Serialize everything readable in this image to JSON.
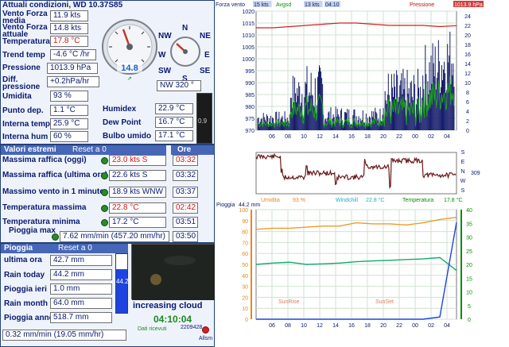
{
  "current": {
    "title": "Attuali condizioni, WD 10.37S85",
    "wind_avg_label": "Vento Forza media",
    "wind_avg": "11.9 kts",
    "wind_now_label": "Vento Forza attuale",
    "wind_now": "14.8 kts",
    "temp_label": "Temperatura",
    "temp": "17.8 °C",
    "trend_label": "Trend temp",
    "trend": "-4.6 °C /hr",
    "pressure_label": "Pressione",
    "pressure": "1013.9 hPa",
    "diff_label": "Diff. pressione",
    "diff": "+0.2hPa/hr",
    "humidity_label": "Umidita",
    "humidity": "93 %",
    "dewpoint_label": "Punto dep.",
    "dewpoint": "1.1 °C",
    "intemp_label": "Interna temp.",
    "intemp": "25.9 °C",
    "inhum_label": "Interna hum",
    "inhum": "60 %",
    "humidex_label": "Humidex",
    "humidex": "22.9 °C",
    "dew2_label": "Dew Point",
    "dew2": "16.7 °C",
    "wetbulb_label": "Bulbo umido",
    "wetbulb": "17.1 °C",
    "gauge_value": "14.8",
    "compass": {
      "n": "N",
      "ne": "NE",
      "nw": "NW",
      "w": "W",
      "e": "E",
      "s": "S",
      "sw": "SW",
      "se": "SE",
      "reading": "NW  320 °"
    },
    "small_meter": "0.9"
  },
  "extremes": {
    "header": "Valori estremi",
    "reset": "Reset a 0",
    "time_header": "Ore",
    "rows": [
      {
        "label": "Massima raffica (oggi)",
        "value": "23.0 kts   S",
        "time": "03:32",
        "red": true
      },
      {
        "label": "Massima raffica (ultima ora)",
        "value": "22.6 kts   S",
        "time": "03:32",
        "red": false
      },
      {
        "label": "Massimo vento in 1 minuto",
        "value": "18.9 kts WNW",
        "time": "03:37",
        "red": false
      },
      {
        "label": "Temperatura massima",
        "value": "22.8 °C",
        "time": "02:42",
        "red": true
      },
      {
        "label": "Temperatura minima",
        "value": "17.2 °C",
        "time": "03:51",
        "red": false
      },
      {
        "label": "Pioggia max",
        "value": "7.62 mm/min (457.20 mm/hr)",
        "time": "03:50",
        "red": false
      }
    ]
  },
  "rain": {
    "header": "Pioggia",
    "reset": "Reset a 0",
    "last_hour_label": "ultima ora",
    "last_hour": "42.7 mm",
    "today_label": "Rain today",
    "today": "44.2 mm",
    "yesterday_label": "Pioggia ieri",
    "yesterday": "1.0 mm",
    "month_label": "Rain month",
    "month": "64.0 mm",
    "year_label": "Pioggia anno",
    "year": "518.7 mm",
    "rate": "0.32 mm/min (19.05 mm/hr)",
    "gauge": "44.2",
    "gauge_fill": 0.74
  },
  "status": {
    "forecast": "increasing cloud",
    "clock": "04:10:04",
    "received_label": "Dati ricevuti",
    "received_count": "2209428",
    "alarm_label": "Allsm"
  },
  "chart_data": [
    {
      "type": "line",
      "legend": [
        "Forza vento",
        "15 kts",
        "Avgsd",
        "13 kts",
        "04:10",
        "Pressione",
        "1013.9 hPa"
      ],
      "x_ticks": [
        "06",
        "08",
        "10",
        "12",
        "14",
        "16",
        "18",
        "20",
        "22",
        "00",
        "02",
        "04"
      ],
      "y_left_ticks": [
        970,
        975,
        980,
        985,
        990,
        995,
        1000,
        1005,
        1010,
        1015,
        1020
      ],
      "y_right_ticks": [
        0,
        2,
        4,
        6,
        8,
        10,
        12,
        14,
        16,
        18,
        20,
        22,
        24
      ],
      "series": [
        {
          "name": "Pressione",
          "values": [
            1013,
            1013,
            1013.5,
            1014,
            1014.5,
            1015,
            1015,
            1014.5,
            1014,
            1014,
            1014,
            1013.5,
            1013.9
          ]
        }
      ]
    },
    {
      "type": "line",
      "right_labels": [
        "S",
        "E",
        "N",
        "W",
        "S"
      ],
      "right_value": "309"
    },
    {
      "type": "line",
      "legend": [
        "Pioggia",
        "44.2 mm",
        "Umidita",
        "93 %",
        "Windchill",
        "22.8 °C",
        "Temperatura",
        "17.8 °C"
      ],
      "x_ticks": [
        "06",
        "08",
        "10",
        "12",
        "14",
        "16",
        "18",
        "20",
        "22",
        "00",
        "02",
        "04"
      ],
      "y_left_ticks": [
        0,
        10,
        20,
        30,
        40,
        50,
        60,
        70,
        80,
        90,
        100
      ],
      "y_right_ticks": [
        0,
        5,
        10,
        15,
        20,
        25,
        30,
        35,
        40
      ],
      "annotations": [
        "SunRise",
        "SunSet"
      ],
      "series": [
        {
          "name": "Umidita",
          "values": [
            82,
            83,
            83,
            84,
            85,
            85,
            88,
            87,
            87,
            86,
            88,
            91,
            93
          ]
        },
        {
          "name": "Temperatura",
          "values": [
            20,
            20.5,
            20.8,
            20,
            20.2,
            20.5,
            21,
            21.3,
            21.5,
            21.8,
            22,
            22.5,
            17.8
          ]
        },
        {
          "name": "Pioggia",
          "values": [
            0,
            0,
            0,
            0,
            0,
            0,
            0,
            0,
            0,
            0,
            0,
            1,
            44.2
          ]
        }
      ]
    }
  ]
}
